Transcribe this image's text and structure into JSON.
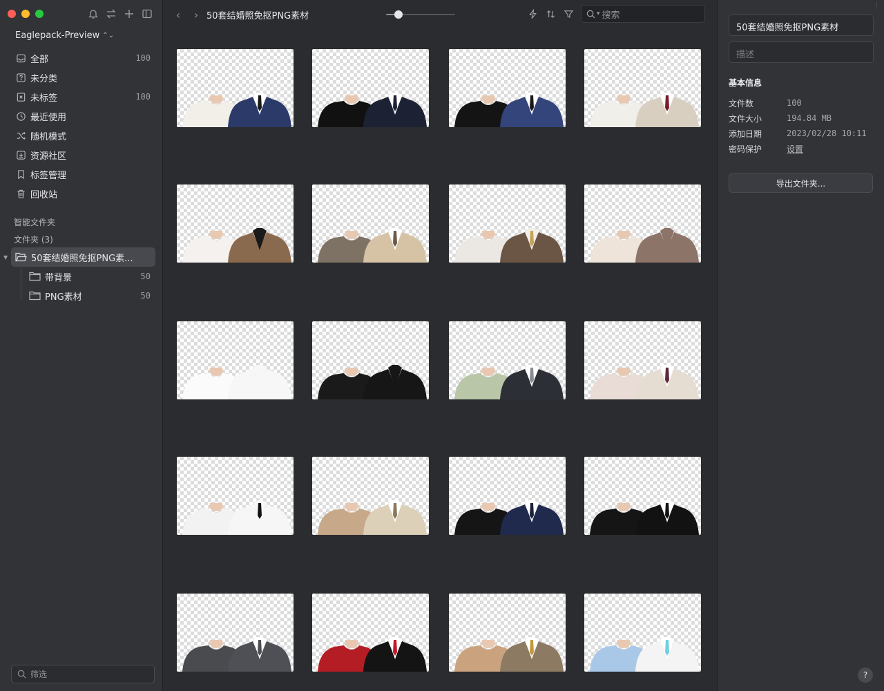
{
  "sidebar": {
    "library_name": "Eaglepack-Preview",
    "library_chevron": "⌃",
    "nav": [
      {
        "label": "全部",
        "count": "100",
        "icon": "inbox-icon"
      },
      {
        "label": "未分类",
        "count": "",
        "icon": "question-box-icon"
      },
      {
        "label": "未标签",
        "count": "100",
        "icon": "untagged-icon"
      },
      {
        "label": "最近使用",
        "count": "",
        "icon": "clock-icon"
      },
      {
        "label": "随机模式",
        "count": "",
        "icon": "shuffle-icon"
      },
      {
        "label": "资源社区",
        "count": "",
        "icon": "community-icon"
      },
      {
        "label": "标签管理",
        "count": "",
        "icon": "bookmark-icon"
      },
      {
        "label": "回收站",
        "count": "",
        "icon": "trash-icon"
      }
    ],
    "smart_folders_label": "智能文件夹",
    "folders_label": "文件夹 (3)",
    "folders": [
      {
        "label": "50套结婚照免抠PNG素...",
        "count": ""
      },
      {
        "label": "带背景",
        "count": "50"
      },
      {
        "label": "PNG素材",
        "count": "50"
      }
    ],
    "filter_placeholder": "筛选"
  },
  "toolbar": {
    "back": "‹",
    "forward": "›",
    "title": "50套结婚照免抠PNG素材",
    "zoom_level": 0.18,
    "search_placeholder": "搜索",
    "search_dropdown": "▾"
  },
  "grid": {
    "columns": 4,
    "rows": 5,
    "items": [
      {
        "left": "#f2efe9",
        "right": "#2c3a6a",
        "shirt": "#ffffff",
        "tie": "#1a1a1a"
      },
      {
        "left": "#111111",
        "right": "#1c2233",
        "shirt": "#ffffff",
        "tie": "#1c2233"
      },
      {
        "left": "#141414",
        "right": "#33457a",
        "shirt": "#ffffff",
        "tie": "#1a1a1a"
      },
      {
        "left": "#f1efe9",
        "right": "#d9cfc0",
        "shirt": "#ffffff",
        "tie": "#7a1a2a"
      },
      {
        "left": "#f4f1ee",
        "right": "#8a6a4e",
        "shirt": "#1a1a1a",
        "tie": "#1a1a1a"
      },
      {
        "left": "#7d7263",
        "right": "#d6c3a5",
        "shirt": "#ffffff",
        "tie": "#6a5a4a"
      },
      {
        "left": "#ebe8e4",
        "right": "#6b5645",
        "shirt": "#f2efe9",
        "tie": "#c6a25a"
      },
      {
        "left": "#efe4da",
        "right": "#8c7468",
        "shirt": "#8c7468",
        "tie": "#8c7468"
      },
      {
        "left": "#fbfbfb",
        "right": "#f7f7f7",
        "shirt": "#f7f7f7",
        "tie": "#f7f7f7"
      },
      {
        "left": "#1a1a1a",
        "right": "#161616",
        "shirt": "#161616",
        "tie": "#161616"
      },
      {
        "left": "#b9c6a8",
        "right": "#2d2f36",
        "shirt": "#ffffff",
        "tie": "#8a8c93"
      },
      {
        "left": "#e9dcd6",
        "right": "#e6ddd2",
        "shirt": "#ffffff",
        "tie": "#5a2a3a"
      },
      {
        "left": "#f2f2f2",
        "right": "#f6f6f6",
        "shirt": "#f6f6f6",
        "tie": "#111111"
      },
      {
        "left": "#c7a98a",
        "right": "#ddd0b8",
        "shirt": "#ffffff",
        "tie": "#8a7a5a"
      },
      {
        "left": "#151515",
        "right": "#1f2a4d",
        "shirt": "#ffffff",
        "tie": "#1a2238"
      },
      {
        "left": "#151515",
        "right": "#121212",
        "shirt": "#ffffff",
        "tie": "#121212"
      },
      {
        "left": "#4a4b4f",
        "right": "#4f5055",
        "shirt": "#ffffff",
        "tie": "#4f5055"
      },
      {
        "left": "#b51d24",
        "right": "#141414",
        "shirt": "#ffffff",
        "tie": "#c4162a"
      },
      {
        "left": "#caa27d",
        "right": "#8d7a63",
        "shirt": "#ffffff",
        "tie": "#c39a3a"
      },
      {
        "left": "#a9c8e8",
        "right": "#f4f4f4",
        "shirt": "#ffffff",
        "tie": "#6fd0e0"
      }
    ]
  },
  "inspector": {
    "title": "50套结婚照免抠PNG素材",
    "description_placeholder": "描述",
    "section_heading": "基本信息",
    "rows": [
      {
        "key": "文件数",
        "value": "100"
      },
      {
        "key": "文件大小",
        "value": "194.84 MB"
      },
      {
        "key": "添加日期",
        "value": "2023/02/28 10:11"
      },
      {
        "key": "密码保护",
        "value": "设置"
      }
    ],
    "export_label": "导出文件夹...",
    "help_label": "?"
  },
  "colors": {
    "window_bg": "#2b2c2f",
    "sidebar_bg": "#323337",
    "selection_bg": "#48494e"
  }
}
